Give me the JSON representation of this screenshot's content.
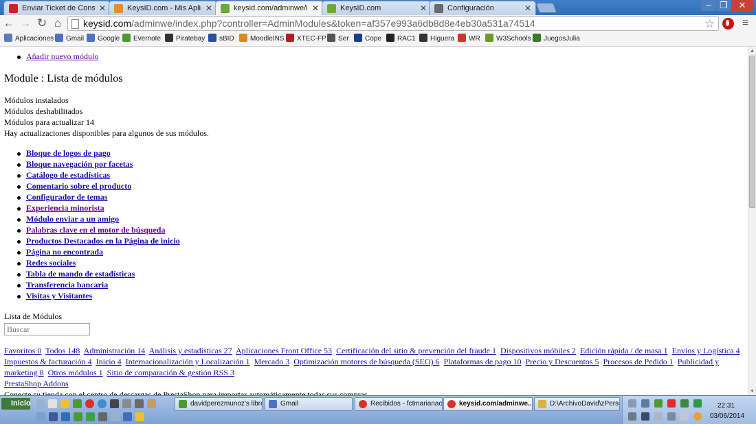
{
  "tabs": [
    {
      "title": "Enviar Ticket de Consulta - w",
      "icon": "ticket-icon",
      "color": "#cc2222"
    },
    {
      "title": "KeysID.com - Mis Aplicacione",
      "icon": "cpanel-icon",
      "color": "#f08a24"
    },
    {
      "title": "keysid.com/adminwe/index.p",
      "icon": "prestashop-icon",
      "color": "#6fa83a"
    },
    {
      "title": "KeysID.com",
      "icon": "prestashop-icon",
      "color": "#6fa83a"
    },
    {
      "title": "Configuración",
      "icon": "wrench-icon",
      "color": "#6a6a6a"
    }
  ],
  "window": {
    "minimize": "–",
    "maximize": "❐",
    "close": "✕"
  },
  "toolbar": {
    "back": "←",
    "forward": "→",
    "reload": "↻",
    "home": "⌂",
    "url_host": "keysid.com",
    "url_rest": "/adminwe/index.php?controller=AdminModules&token=af357e993a6db8d8e4eb30a531a74514",
    "star": "☆",
    "menu": "≡"
  },
  "bookmarks": [
    {
      "label": "Aplicaciones",
      "icon": "apps-icon",
      "color": "#5b7bb8"
    },
    {
      "label": "Gmail",
      "icon": "gmail-icon",
      "color": "#4f70c4"
    },
    {
      "label": "Google",
      "icon": "google-icon",
      "color": "#4f70c4"
    },
    {
      "label": "Evernote",
      "icon": "evernote-icon",
      "color": "#4d9a2f"
    },
    {
      "label": "Piratebay",
      "icon": "pirate-ship-icon",
      "color": "#333333"
    },
    {
      "label": "sBID",
      "icon": "sbid-icon",
      "color": "#2a4fa0"
    },
    {
      "label": "MoodleINS",
      "icon": "moodle-icon",
      "color": "#d98b1a"
    },
    {
      "label": "XTEC-FP",
      "icon": "xtec-icon",
      "color": "#b02222"
    },
    {
      "label": "Ser",
      "icon": "ser-icon",
      "color": "#555555"
    },
    {
      "label": "Cope",
      "icon": "cope-icon",
      "color": "#1a3c8a"
    },
    {
      "label": "RAC1",
      "icon": "rac1-icon",
      "color": "#222222"
    },
    {
      "label": "Higuera",
      "icon": "higuera-icon",
      "color": "#333333"
    },
    {
      "label": "WR",
      "icon": "wr-icon",
      "color": "#d9302b"
    },
    {
      "label": "W3Schools",
      "icon": "w3schools-icon",
      "color": "#6a9a2a"
    },
    {
      "label": "JuegosJulia",
      "icon": "game-icon",
      "color": "#3a7a2a"
    }
  ],
  "page": {
    "add_module_link": "Añadir nuevo módulo",
    "heading": "Module : Lista de módulos",
    "installed": "Módulos instalados",
    "disabled": "Módulos deshabilitados",
    "to_update": "Módulos para actualizar 14",
    "updates_notice": "Hay actualizaciones disponibles para algunos de sus módulos.",
    "modules": [
      "Bloque de logos de pago",
      "Bloque navegación por facetas",
      "Catálogo de estadísticas",
      "Comentario sobre el producto",
      "Configurador de temas",
      "Experiencia minorista",
      "Módulo enviar a un amigo",
      "Palabras clave en el motor de búsqueda",
      "Productos Destacados en la Página de inicio",
      "Página no encontrada",
      "Redes sociales",
      "Tabla de mando de estadísticas",
      "Transferencia bancaria",
      "Visitas y Visitantes"
    ],
    "list_label": "Lista de Módulos",
    "search_placeholder": "Buscar",
    "categories": [
      "Favoritos 0",
      "Todos 148",
      "Administración 14",
      "Análisis y estadísticas 27",
      "Aplicaciones Front Office 53",
      "Certificación del sitio & prevención del fraude 1",
      "Dispositivos móbiles 2",
      "Edición rápida / de masa 1",
      "Envíos y Logística 4",
      "Impuestos & facturación 4",
      "Inicio 4",
      "Internacionalización y Localización 1",
      "Mercado 3",
      "Optimización motores de búsqueda (SEO) 6",
      "Plataformas de pago 10",
      "Precio y Descuentos 5",
      "Procesos de Pedido 1",
      "Publicidad y marketing 8",
      "Otros módulos 1",
      "Sitio de comparación & gestión RSS 3"
    ],
    "addons_link": "PrestaShop Addons",
    "addons_text": "Conecte su tienda con el centro de descargas de PrestaShop para importar automáticamente todas sus compras."
  },
  "scrollbar": {
    "up": "▲",
    "down": "▼"
  },
  "taskbar": {
    "start": "Inicio",
    "tasks": [
      {
        "label": "davidperezmunoz's libret...",
        "icon": "task-app-icon",
        "color": "#4d9a2f"
      },
      {
        "label": "Gmail",
        "icon": "gmail-icon",
        "color": "#4f70c4"
      },
      {
        "label": "Recibidos - fctmarianao...",
        "icon": "chrome-icon",
        "color": "#d9302b"
      },
      {
        "label": "keysid.com/adminwe...",
        "icon": "chrome-icon",
        "color": "#d9302b"
      },
      {
        "label": "D:\\ArchivoDavid\\zPerso...",
        "icon": "folder-icon",
        "color": "#d9b43a"
      }
    ],
    "time": "22:31",
    "date": "03/06/2014"
  }
}
